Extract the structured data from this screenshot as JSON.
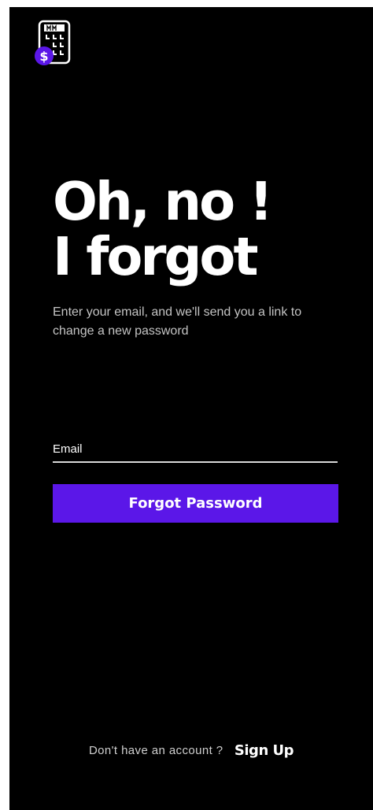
{
  "heading": {
    "line1": "Oh, no !",
    "line2": "I forgot"
  },
  "subtitle": "Enter your email,  and we'll send you a link to change a new password",
  "email": {
    "placeholder": "Email",
    "value": ""
  },
  "submit_label": "Forgot Password",
  "footer": {
    "prompt": "Don't have an account ?",
    "signup_label": "Sign Up"
  },
  "icons": {
    "logo": "calculator-dollar-icon"
  },
  "colors": {
    "background": "#000000",
    "accent": "#5b17e8",
    "text": "#ffffff",
    "muted_text": "#c4c4c4"
  }
}
